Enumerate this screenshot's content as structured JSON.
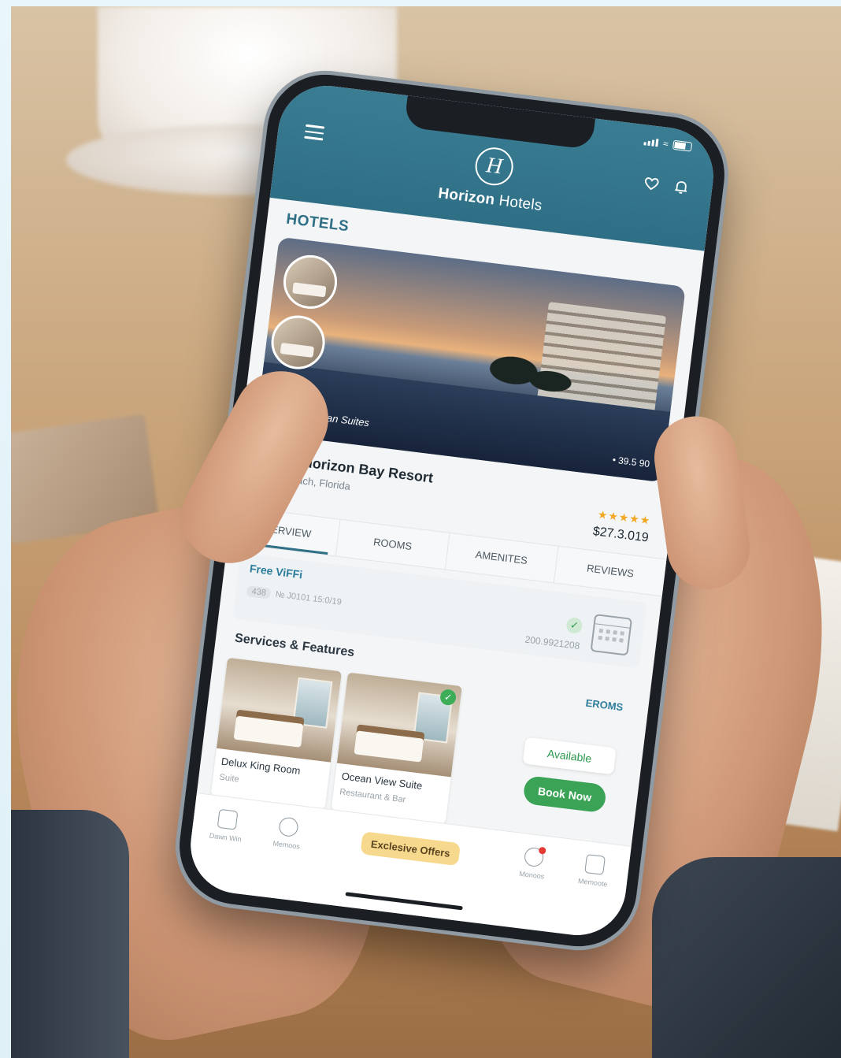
{
  "app": {
    "brand_bold": "Horizon",
    "brand_light": "Hotels",
    "logo_letter": "H"
  },
  "section": {
    "title": "HOTELS"
  },
  "hero": {
    "caption": "Horizon Diban Suites",
    "rating_text": "• 39.5 90"
  },
  "hotel": {
    "name": "Grand Horizon Bay Resort",
    "location": "Miami Beach, Florida",
    "stars": "★★★★★",
    "star_count": 5,
    "price": "$27.3.019"
  },
  "tabs": [
    {
      "label": "OVERVIEW",
      "active": true
    },
    {
      "label": "ROOMS",
      "active": false
    },
    {
      "label": "AMENITES",
      "active": false
    },
    {
      "label": "REVIEWS",
      "active": false
    }
  ],
  "wifi": {
    "title": "Free ViFFi",
    "chip": "438",
    "meta": "№ J0101 15:0/19",
    "code": "200.9921208"
  },
  "services": {
    "title": "Services & Features",
    "rooms_link": "EROMS",
    "rooms": [
      {
        "name": "Delux King Room",
        "subtitle": "Suite",
        "checked": false
      },
      {
        "name": "Ocean View Suite",
        "subtitle": "Restaurant & Bar",
        "checked": true
      }
    ],
    "available_label": "Available",
    "book_label": "Book Now"
  },
  "bottom_nav": {
    "items": [
      {
        "label": "Dawn Win",
        "icon": "home-icon"
      },
      {
        "label": "Memoos",
        "icon": "clock-icon"
      },
      {
        "label": "Monoos",
        "icon": "bell-icon"
      },
      {
        "label": "Memoote",
        "icon": "bag-icon"
      }
    ],
    "offers_label": "Exclesive Offers"
  },
  "colors": {
    "header": "#2f6f86",
    "accent_green": "#3aa356",
    "star": "#f2a823",
    "offers": "#f7d98d"
  }
}
